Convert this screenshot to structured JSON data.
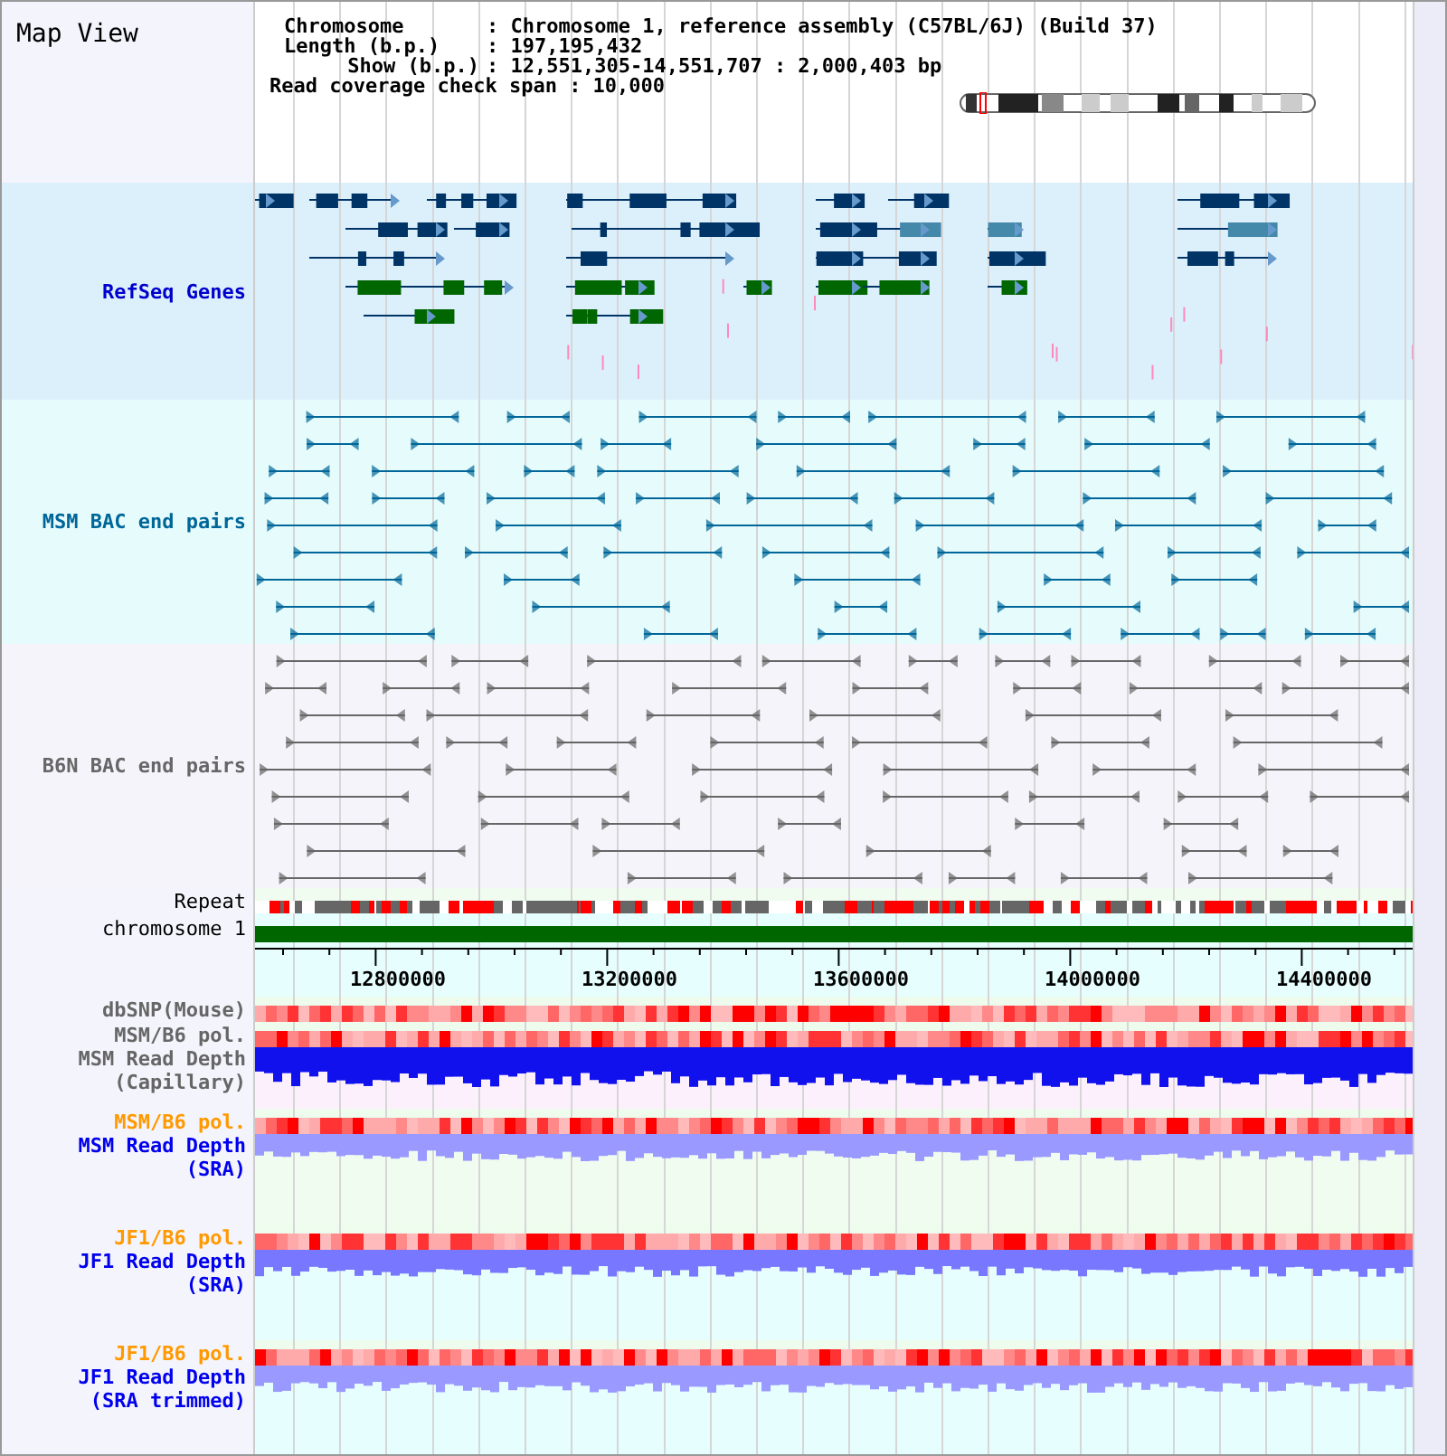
{
  "title": "Map View",
  "info": [
    {
      "label": "Chromosome",
      "value": ": Chromosome 1, reference assembly (C57BL/6J) (Build 37)"
    },
    {
      "label": "Length (b.p.)",
      "value": ": 197,195,432"
    },
    {
      "label": "Show (b.p.)",
      "value": ": 12,551,305-14,551,707 : 2,000,403 bp"
    }
  ],
  "coverage": "Read coverage check span : 10,000",
  "tracks": [
    {
      "label": "RefSeq Genes",
      "kind": "genes",
      "color": "#0000cc"
    },
    {
      "label": "MSM BAC end pairs",
      "kind": "pairs",
      "color": "#006699"
    },
    {
      "label": "B6N BAC end pairs",
      "kind": "pairs",
      "color": "#666666"
    },
    {
      "label": "Repeat",
      "kind": "repeat",
      "color": "#000000"
    },
    {
      "label": "chromosome 1",
      "kind": "chromosome",
      "color": "#000000"
    },
    {
      "kind": "ruler",
      "ticks": [
        "12800000",
        "13200000",
        "13600000",
        "14000000",
        "14400000"
      ]
    },
    {
      "label": "dbSNP(Mouse)",
      "kind": "heat",
      "color": "#666666"
    },
    {
      "label": "MSM/B6 pol.",
      "kind": "heat",
      "color": "#666666"
    },
    {
      "label": "MSM Read Depth\n(Capillary)",
      "kind": "depth",
      "color": "#666666"
    },
    {
      "label": "MSM/B6 pol.",
      "kind": "heat",
      "color": "#ff9900"
    },
    {
      "label": "MSM Read Depth\n(SRA)",
      "kind": "depth",
      "color": "#0000ee"
    },
    {
      "label": "JF1/B6 pol.",
      "kind": "heat",
      "color": "#ff9900"
    },
    {
      "label": "JF1 Read Depth\n(SRA)",
      "kind": "depth",
      "color": "#0000ee"
    },
    {
      "label": "JF1/B6 pol.",
      "kind": "heat",
      "color": "#ff9900"
    },
    {
      "label": "JF1 Read Depth\n(SRA trimmed)",
      "kind": "depth",
      "color": "#0000ee"
    }
  ]
}
